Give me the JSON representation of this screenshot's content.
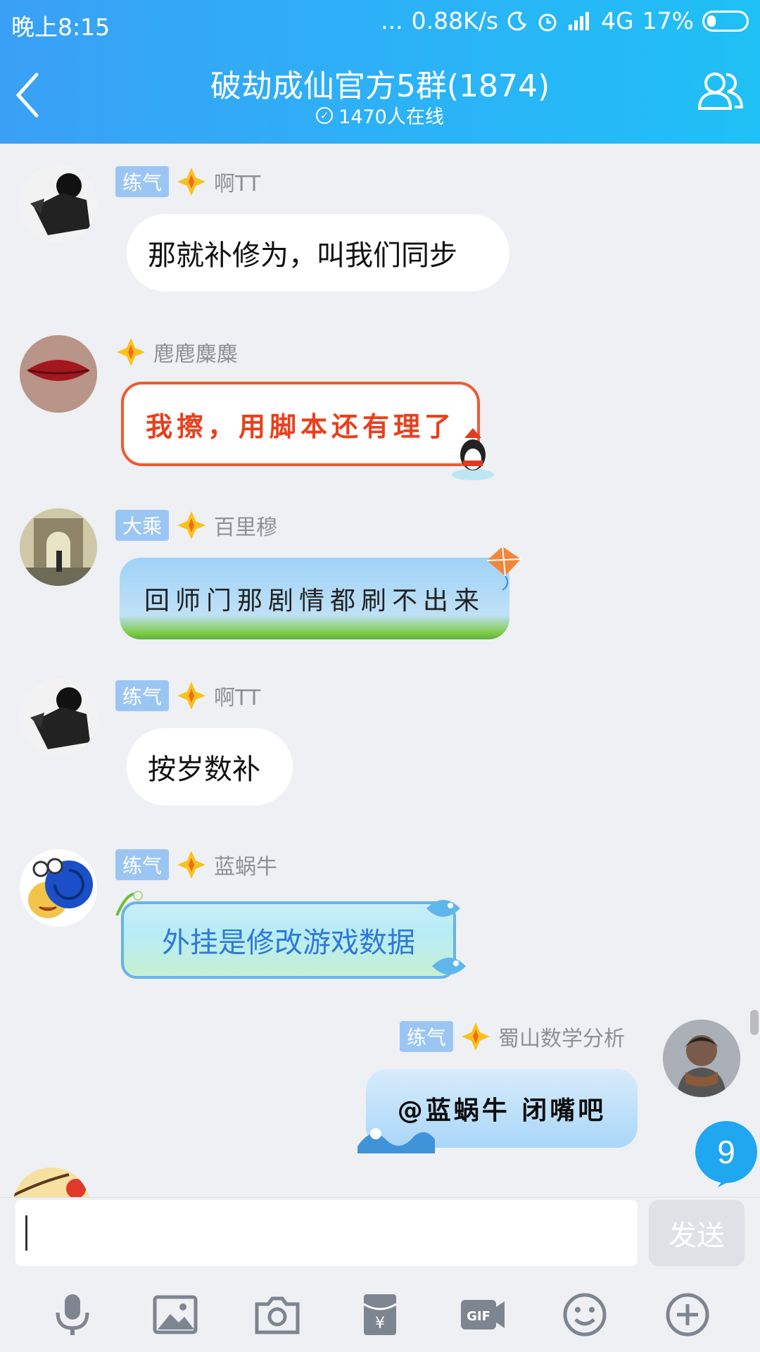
{
  "status_bar": {
    "time": "晚上8:15",
    "dots": "...",
    "speed": "0.88K/s",
    "network": "4G",
    "battery": "17%"
  },
  "header": {
    "title": "破劫成仙官方5群(1874)",
    "online": "1470人在线",
    "back_icon": "chevron-left-icon",
    "members_icon": "group-members-icon"
  },
  "messages": [
    {
      "tag": "练气",
      "name": "啊TT",
      "text": "那就补修为，叫我们同步",
      "style": "plain"
    },
    {
      "tag": "",
      "name": "麀麀麋麋",
      "text": "我擦，用脚本还有理了",
      "style": "red-frame"
    },
    {
      "tag": "大乘",
      "name": "百里穆",
      "text": "回师门那剧情都刷不出来",
      "style": "kite-sky"
    },
    {
      "tag": "练气",
      "name": "啊TT",
      "text": "按岁数补",
      "style": "plain"
    },
    {
      "tag": "练气",
      "name": "蓝蜗牛",
      "text": "外挂是修改游戏数据",
      "style": "aqua-frame"
    },
    {
      "tag": "练气",
      "name": "蜀山数学分析",
      "text": "@蓝蜗牛 闭嘴吧",
      "style": "mine-wave"
    }
  ],
  "unread_badge": "9",
  "input": {
    "placeholder": "",
    "send_label": "发送"
  },
  "toolbar": [
    "mic-icon",
    "image-icon",
    "camera-icon",
    "red-packet-icon",
    "gif-icon",
    "emoji-icon",
    "plus-icon"
  ],
  "colors": {
    "header_start": "#3aa0f6",
    "header_end": "#1fc0f5",
    "tag": "#9bc6f3",
    "badge": "#1fa7f0"
  }
}
